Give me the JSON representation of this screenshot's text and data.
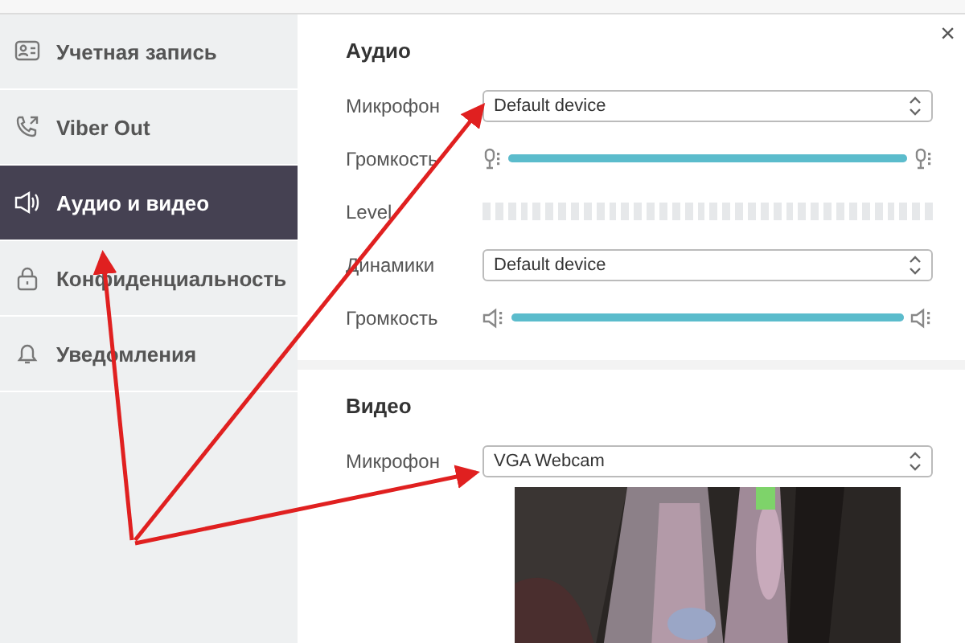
{
  "sidebar": {
    "items": [
      {
        "label": "Учетная запись",
        "selected": false
      },
      {
        "label": "Viber Out",
        "selected": false
      },
      {
        "label": "Аудио и видео",
        "selected": true
      },
      {
        "label": "Конфиденциальность",
        "selected": false
      },
      {
        "label": "Уведомления",
        "selected": false
      }
    ]
  },
  "close": "×",
  "audio": {
    "title": "Аудио",
    "rows": [
      {
        "kind": "select",
        "label": "Микрофон",
        "value": "Default device"
      },
      {
        "kind": "mic-slider",
        "label": "Громкость",
        "level": 1
      },
      {
        "kind": "meter",
        "label": "Level"
      },
      {
        "kind": "select",
        "label": "Динамики",
        "value": "Default device"
      },
      {
        "kind": "speaker-slider",
        "label": "Громкость",
        "level": 1
      }
    ]
  },
  "video": {
    "title": "Видео",
    "rows": [
      {
        "kind": "select",
        "label": "Микрофон",
        "value": "VGA Webcam"
      }
    ]
  }
}
